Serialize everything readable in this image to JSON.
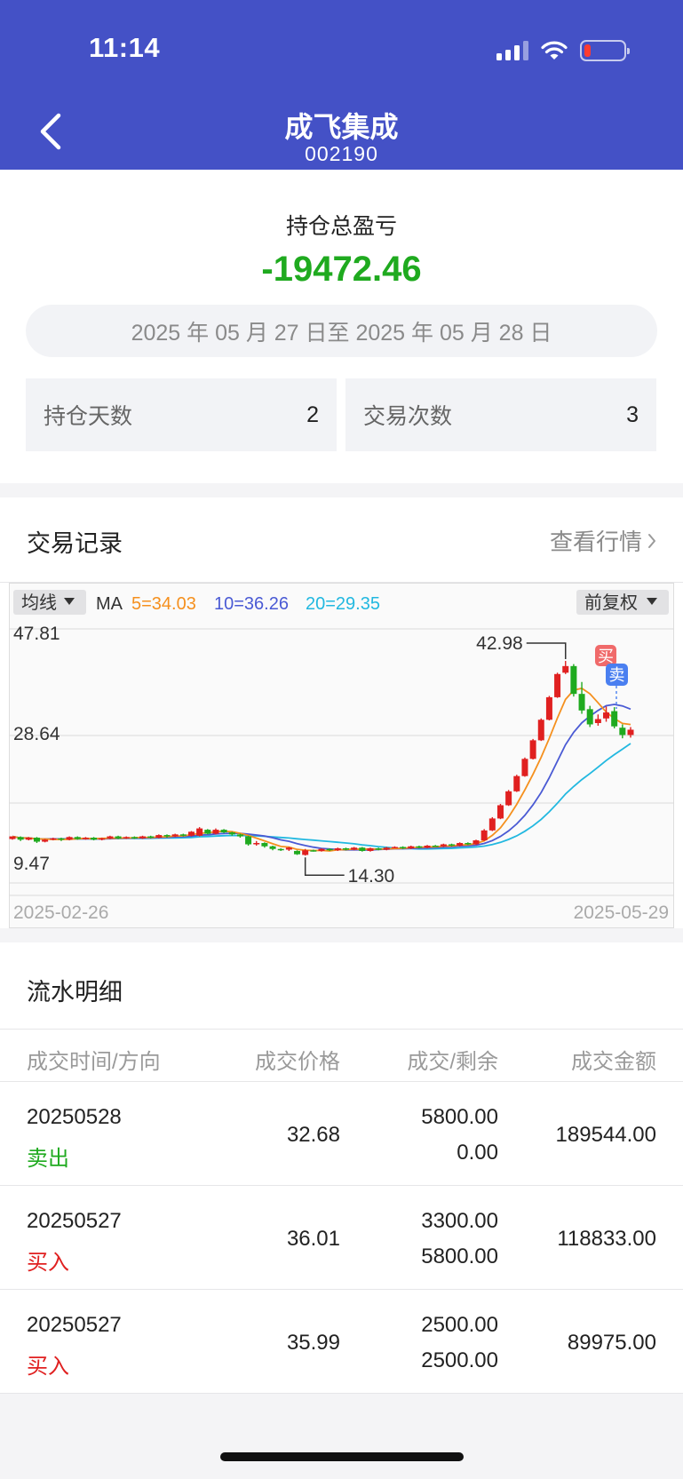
{
  "status_bar": {
    "time": "11:14"
  },
  "header": {
    "title": "成飞集成",
    "code": "002190"
  },
  "summary": {
    "label": "持仓总盈亏",
    "value": "-19472.46",
    "date_range": "2025 年 05 月 27 日至 2025 年 05 月 28 日",
    "hold_days_label": "持仓天数",
    "hold_days": "2",
    "trade_count_label": "交易次数",
    "trade_count": "3"
  },
  "records": {
    "title": "交易记录",
    "view_quote": "查看行情"
  },
  "chart_data": {
    "type": "candlestick",
    "controls": {
      "indicator": "均线",
      "adjust": "前复权"
    },
    "ma_label": "MA",
    "ma": {
      "ma5": "5=34.03",
      "ma10": "10=36.26",
      "ma20": "20=29.35"
    },
    "y_ticks": [
      "47.81",
      "28.64",
      "9.47"
    ],
    "ylim": [
      9.47,
      47.81
    ],
    "x_start": "2025-02-26",
    "x_end": "2025-05-29",
    "high_label": "42.98",
    "low_label": "14.30",
    "buy_marker": "买",
    "sell_marker": "卖",
    "colors": {
      "up": "#e02020",
      "down": "#1faa1f",
      "ma5": "#f5901e",
      "ma10": "#4a5ad4",
      "ma20": "#22b8e0"
    },
    "candles": [
      [
        16.1,
        16.5,
        16.3,
        16.0
      ],
      [
        16.4,
        16.0,
        16.5,
        15.8
      ],
      [
        16.0,
        16.3,
        16.4,
        15.9
      ],
      [
        16.3,
        15.7,
        16.4,
        15.5
      ],
      [
        15.7,
        16.0,
        16.1,
        15.6
      ],
      [
        16.0,
        16.2,
        16.3,
        15.9
      ],
      [
        16.2,
        16.0,
        16.3,
        15.8
      ],
      [
        16.0,
        16.4,
        16.5,
        15.9
      ],
      [
        16.4,
        16.1,
        16.5,
        16.0
      ],
      [
        16.1,
        16.3,
        16.4,
        16.0
      ],
      [
        16.3,
        16.0,
        16.4,
        15.9
      ],
      [
        16.0,
        16.2,
        16.3,
        15.9
      ],
      [
        16.2,
        16.5,
        16.6,
        16.1
      ],
      [
        16.5,
        16.2,
        16.6,
        16.1
      ],
      [
        16.2,
        16.4,
        16.5,
        16.1
      ],
      [
        16.4,
        16.2,
        16.5,
        16.1
      ],
      [
        16.2,
        16.5,
        16.6,
        16.1
      ],
      [
        16.5,
        16.3,
        16.6,
        16.2
      ],
      [
        16.3,
        16.7,
        16.8,
        16.2
      ],
      [
        16.7,
        16.5,
        16.8,
        16.3
      ],
      [
        16.5,
        16.8,
        16.9,
        16.4
      ],
      [
        16.8,
        16.6,
        16.9,
        16.5
      ],
      [
        16.6,
        17.2,
        17.3,
        16.5
      ],
      [
        16.6,
        17.7,
        17.9,
        16.5
      ],
      [
        17.5,
        16.9,
        17.6,
        16.8
      ],
      [
        16.9,
        17.5,
        17.7,
        16.8
      ],
      [
        17.5,
        17.1,
        17.6,
        17.0
      ],
      [
        17.1,
        16.8,
        17.2,
        16.6
      ],
      [
        16.8,
        16.5,
        16.9,
        16.3
      ],
      [
        16.5,
        15.3,
        16.6,
        15.1
      ],
      [
        15.3,
        15.5,
        15.8,
        15.1
      ],
      [
        15.5,
        15.0,
        15.6,
        14.8
      ],
      [
        15.0,
        14.6,
        15.1,
        14.4
      ],
      [
        14.6,
        14.5,
        14.7,
        14.3
      ],
      [
        14.5,
        14.8,
        14.9,
        14.3
      ],
      [
        14.3,
        13.8,
        14.4,
        13.7
      ],
      [
        13.7,
        14.4,
        14.6,
        13.6
      ],
      [
        14.4,
        14.3,
        14.5,
        14.2
      ],
      [
        14.3,
        14.6,
        14.7,
        14.2
      ],
      [
        14.6,
        14.4,
        14.7,
        14.3
      ],
      [
        14.4,
        14.7,
        14.8,
        14.3
      ],
      [
        14.7,
        14.5,
        14.8,
        14.4
      ],
      [
        14.5,
        14.8,
        14.9,
        14.4
      ],
      [
        14.8,
        14.3,
        14.9,
        14.2
      ],
      [
        14.3,
        14.7,
        14.8,
        14.2
      ],
      [
        14.7,
        14.5,
        14.8,
        14.4
      ],
      [
        14.5,
        14.8,
        14.9,
        14.4
      ],
      [
        14.8,
        14.9,
        15.0,
        14.7
      ],
      [
        14.9,
        14.7,
        15.0,
        14.6
      ],
      [
        14.7,
        15.0,
        15.1,
        14.6
      ],
      [
        15.0,
        14.8,
        15.1,
        14.7
      ],
      [
        14.8,
        15.1,
        15.2,
        14.7
      ],
      [
        15.1,
        15.0,
        15.2,
        14.9
      ],
      [
        15.0,
        15.3,
        15.4,
        14.9
      ],
      [
        15.3,
        15.1,
        15.4,
        15.0
      ],
      [
        15.1,
        15.5,
        15.6,
        15.0
      ],
      [
        15.5,
        15.3,
        15.6,
        15.2
      ],
      [
        15.3,
        15.9,
        16.0,
        15.2
      ],
      [
        15.9,
        17.4,
        17.6,
        15.8
      ],
      [
        17.4,
        19.2,
        19.4,
        17.3
      ],
      [
        19.2,
        21.2,
        21.4,
        19.1
      ],
      [
        21.2,
        23.3,
        23.5,
        21.1
      ],
      [
        23.3,
        25.6,
        25.8,
        23.2
      ],
      [
        25.6,
        28.2,
        28.4,
        25.5
      ],
      [
        28.2,
        31.0,
        31.2,
        28.1
      ],
      [
        31.0,
        34.1,
        34.3,
        30.9
      ],
      [
        34.1,
        37.5,
        37.7,
        34.0
      ],
      [
        37.5,
        41.0,
        41.2,
        37.4
      ],
      [
        41.2,
        42.2,
        42.98,
        41.0
      ],
      [
        42.2,
        38.0,
        42.5,
        37.6
      ],
      [
        38.0,
        35.5,
        39.8,
        35.0
      ],
      [
        35.7,
        33.4,
        36.2,
        33.0
      ],
      [
        33.6,
        34.2,
        34.9,
        33.2
      ],
      [
        34.3,
        35.2,
        36.1,
        33.8
      ],
      [
        35.4,
        33.1,
        36.0,
        32.8
      ],
      [
        32.9,
        31.8,
        33.4,
        31.3
      ],
      [
        31.8,
        32.6,
        33.0,
        31.4
      ]
    ]
  },
  "flow": {
    "title": "流水明细",
    "columns": [
      "成交时间/方向",
      "成交价格",
      "成交/剩余",
      "成交金额"
    ],
    "rows": [
      {
        "date": "20250528",
        "direction": "卖出",
        "price": "32.68",
        "qty": "5800.00",
        "remain": "0.00",
        "amount": "189544.00"
      },
      {
        "date": "20250527",
        "direction": "买入",
        "price": "36.01",
        "qty": "3300.00",
        "remain": "5800.00",
        "amount": "118833.00"
      },
      {
        "date": "20250527",
        "direction": "买入",
        "price": "35.99",
        "qty": "2500.00",
        "remain": "2500.00",
        "amount": "89975.00"
      }
    ]
  }
}
